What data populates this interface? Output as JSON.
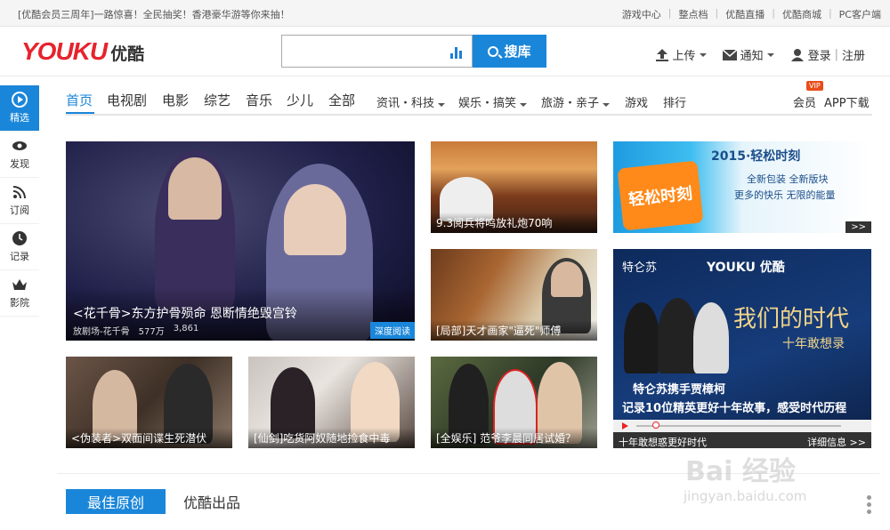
{
  "topbar": {
    "promo": "[优酷会员三周年]一路惊喜！全民抽奖！香港豪华游等你来抽！",
    "links": [
      "游戏中心",
      "整点档",
      "优酷直播",
      "优酷商城",
      "PC客户端"
    ]
  },
  "header": {
    "logo_en": "YOUKU",
    "logo_cn": "优酷",
    "search_value": "",
    "search_button": "搜库",
    "upload": "上传",
    "notify": "通知",
    "login": "登录",
    "register": "注册"
  },
  "rail": [
    {
      "label": "精选",
      "icon": "play-circle-icon",
      "active": true
    },
    {
      "label": "发现",
      "icon": "eye-icon",
      "active": false
    },
    {
      "label": "订阅",
      "icon": "rss-icon",
      "active": false
    },
    {
      "label": "记录",
      "icon": "clock-icon",
      "active": false
    },
    {
      "label": "影院",
      "icon": "crown-icon",
      "active": false
    }
  ],
  "nav": {
    "items": [
      "首页",
      "电视剧",
      "电影",
      "综艺",
      "音乐",
      "少儿",
      "全部"
    ],
    "dropdowns": [
      "资讯・科技",
      "娱乐・搞笑",
      "旅游・亲子"
    ],
    "extras": [
      "游戏",
      "排行"
    ],
    "vip_badge": "VIP",
    "member": "会员",
    "app": "APP下载"
  },
  "tiles": {
    "big": {
      "title": "<花千骨>东方护骨殒命 恩断情绝毁宫铃",
      "channel": "放剧场-花千骨",
      "views": "577万",
      "comments": "3,861",
      "badge": "深度阅读"
    },
    "cannon": {
      "title": "9.3阅兵将鸣放礼炮70响"
    },
    "paint": {
      "title": "[局部]天才画家\"逼死\"师傅"
    },
    "spy": {
      "title": "<伪装者>双面间谍生死潜伏"
    },
    "sword": {
      "title": "[仙剑]吃货阿奴随地捡食中毒"
    },
    "ent": {
      "title": "[全娱乐] 范爷李晨同居试婚？"
    },
    "ad1": {
      "title": "2015·轻松时刻",
      "line1": "全新包装 全新版块",
      "line2": "更多的快乐 无限的能量",
      "logo": "轻松时刻",
      "more": ">>"
    },
    "ad2": {
      "brand": "特仑苏",
      "youku": "YOUKU 优酷",
      "slogan": "我们的时代",
      "sub": "十年敢想录",
      "line1": "特仑苏携手贾樟柯",
      "line2": "记录10位精英更好十年故事，感受时代历程",
      "foot_left": "十年敢想惑更好时代",
      "foot_right": "详细信息 >>"
    }
  },
  "bottom": {
    "tab_active": "最佳原创",
    "tab": "优酷出品"
  },
  "watermark": {
    "main": "Bai 经验",
    "url": "jingyan.baidu.com"
  },
  "colors": {
    "accent": "#1a86d9",
    "logo_red": "#e6232c"
  }
}
